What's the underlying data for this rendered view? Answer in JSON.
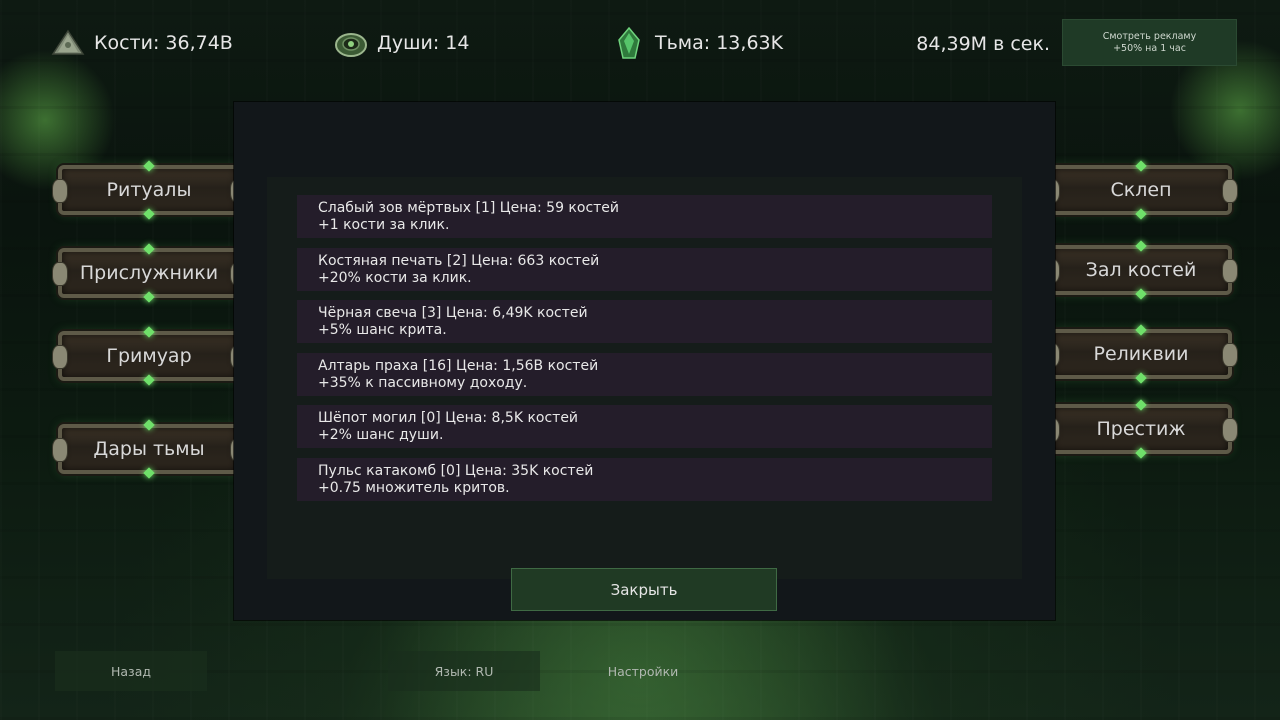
{
  "resources": {
    "bones": {
      "label": "Кости: 36,74B",
      "icon": "bone-pile-icon"
    },
    "souls": {
      "label": "Души: 14",
      "icon": "soul-orb-icon"
    },
    "darkness": {
      "label": "Тьма: 13,63K",
      "icon": "dark-crystal-icon"
    }
  },
  "rate": "84,39M в сек.",
  "ad_button": {
    "line1": "Смотреть рекламу",
    "line2": "+50% на 1 час"
  },
  "left_menu": [
    {
      "label": "Ритуалы"
    },
    {
      "label": "Прислужники"
    },
    {
      "label": "Гримуар"
    },
    {
      "label": "Дары тьмы"
    }
  ],
  "right_menu": [
    {
      "label": "Склеп"
    },
    {
      "label": "Зал костей"
    },
    {
      "label": "Реликвии"
    },
    {
      "label": "Престиж"
    }
  ],
  "upgrades": [
    {
      "title": "Слабый зов мёртвых [1]  Цена: 59 костей",
      "desc": "+1 кости за клик."
    },
    {
      "title": "Костяная печать [2]  Цена: 663 костей",
      "desc": "+20% кости за клик."
    },
    {
      "title": "Чёрная свеча [3]  Цена: 6,49K костей",
      "desc": "+5% шанс крита."
    },
    {
      "title": "Алтарь праха [16]  Цена: 1,56B костей",
      "desc": "+35% к пассивному доходу."
    },
    {
      "title": "Шёпот могил [0]  Цена: 8,5K костей",
      "desc": "+2% шанс души."
    },
    {
      "title": "Пульс катакомб [0]  Цена: 35K костей",
      "desc": "+0.75 множитель критов."
    }
  ],
  "close_label": "Закрыть",
  "bottom": {
    "back": "Назад",
    "language": "Язык: RU",
    "settings": "Настройки"
  },
  "colors": {
    "accent_green": "#203a24",
    "upgrade_bg": "#241d2a",
    "modal_bg": "#12171a"
  }
}
